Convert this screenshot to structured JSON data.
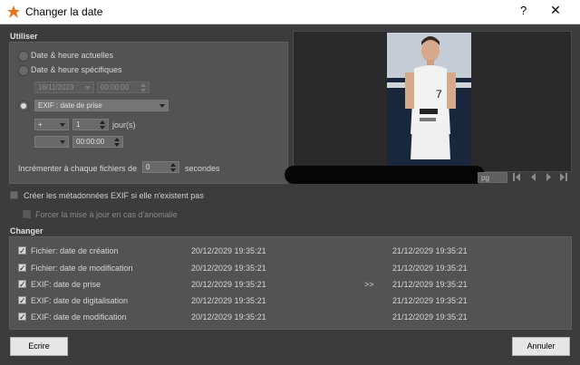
{
  "window": {
    "title": "Changer la date",
    "help": "?",
    "close": "✕"
  },
  "use_section": {
    "title": "Utiliser",
    "radio_current": "Date & heure actuelles",
    "radio_specific": "Date & heure spécifiques",
    "specific_date": "18/11/2023",
    "specific_time": "00:00:00",
    "exif_select": "EXIF : date de prise",
    "offset_sign": "+",
    "offset_value": "1",
    "offset_unit": "jour(s)",
    "offset2_sign": "",
    "offset2_time": "00:00:00",
    "increment_label": "Incrémenter à chaque fichiers de",
    "increment_value": "0",
    "increment_unit": "secondes"
  },
  "options": {
    "create_exif": "Créer les métadonnées EXIF si elle n'existent pas",
    "force_update": "Forcer la mise à jour en cas d'anomalie"
  },
  "preview": {
    "filename_suffix": "pg"
  },
  "change_section": {
    "title": "Changer",
    "arrow": ">>",
    "rows": [
      {
        "label": "Fichier: date de création",
        "old": "20/12/2029 19:35:21",
        "new": "21/12/2029 19:35:21",
        "checked": true
      },
      {
        "label": "Fichier: date de modification",
        "old": "20/12/2029 19:35:21",
        "new": "21/12/2029 19:35:21",
        "checked": true
      },
      {
        "label": "EXIF: date de prise",
        "old": "20/12/2029 19:35:21",
        "new": "21/12/2029 19:35:21",
        "checked": true
      },
      {
        "label": "EXIF: date de digitalisation",
        "old": "20/12/2029 19:35:21",
        "new": "21/12/2029 19:35:21",
        "checked": true
      },
      {
        "label": "EXIF: date de modification",
        "old": "20/12/2029 19:35:21",
        "new": "21/12/2029 19:35:21",
        "checked": true
      }
    ]
  },
  "buttons": {
    "write": "Ecrire",
    "cancel": "Annuler"
  },
  "colors": {
    "background": "#3c3c3c",
    "panel": "#535353",
    "icon_accent": "#e8731a"
  }
}
